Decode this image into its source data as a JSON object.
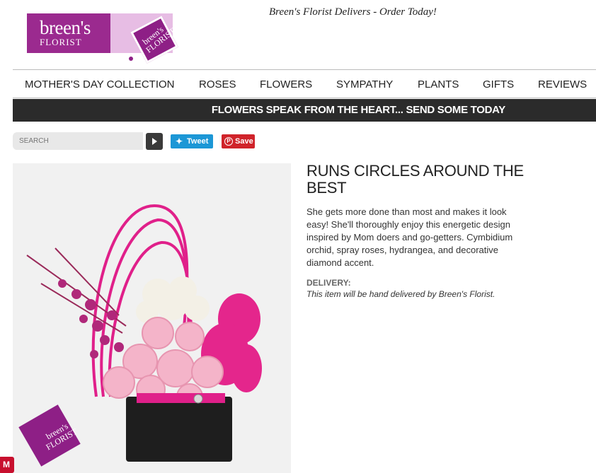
{
  "header": {
    "logo_name": "breen's",
    "logo_sub": "FLORIST",
    "logo_badge": "breen's FLORIST",
    "tagline": "Breen's Florist Delivers - Order Today!"
  },
  "nav": {
    "items": [
      "MOTHER'S DAY COLLECTION",
      "ROSES",
      "FLOWERS",
      "SYMPATHY",
      "PLANTS",
      "GIFTS",
      "REVIEWS"
    ]
  },
  "banner": {
    "text": "FLOWERS SPEAK FROM THE HEART... SEND SOME TODAY"
  },
  "search": {
    "placeholder": "SEARCH"
  },
  "social": {
    "tweet_label": "Tweet",
    "save_label": "Save"
  },
  "product": {
    "title": "RUNS CIRCLES AROUND THE BEST",
    "description": "She gets more done than most and makes it look easy! She'll thoroughly enjoy this energetic design inspired by Mom doers and go-getters. Cymbidium orchid, spray roses, hydrangea, and decorative diamond accent.",
    "delivery_label": "DELIVERY:",
    "delivery_text": "This item will be hand delivered by Breen's Florist.",
    "image_watermark": "breen's FLORIST"
  },
  "badge": {
    "label": "M"
  },
  "colors": {
    "brand_purple": "#9b2a8f",
    "banner_dark": "#2b2b2b",
    "tweet_blue": "#1c97d6",
    "save_red": "#d0232a"
  }
}
